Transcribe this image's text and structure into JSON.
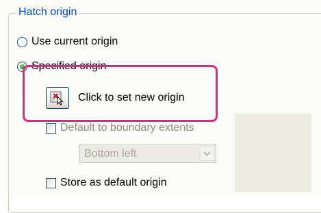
{
  "group": {
    "title": "Hatch origin"
  },
  "options": {
    "use_current": "Use current origin",
    "specified": "Specified origin"
  },
  "set_origin": {
    "label": "Click to set new origin",
    "icon": "set-origin-icon"
  },
  "default_extents": {
    "label": "Default to boundary extents",
    "checked": false
  },
  "position_select": {
    "value": "Bottom left"
  },
  "store_default": {
    "label": "Store as default origin",
    "checked": false
  },
  "colors": {
    "highlight": "#e3267e",
    "title": "#0046d5"
  }
}
